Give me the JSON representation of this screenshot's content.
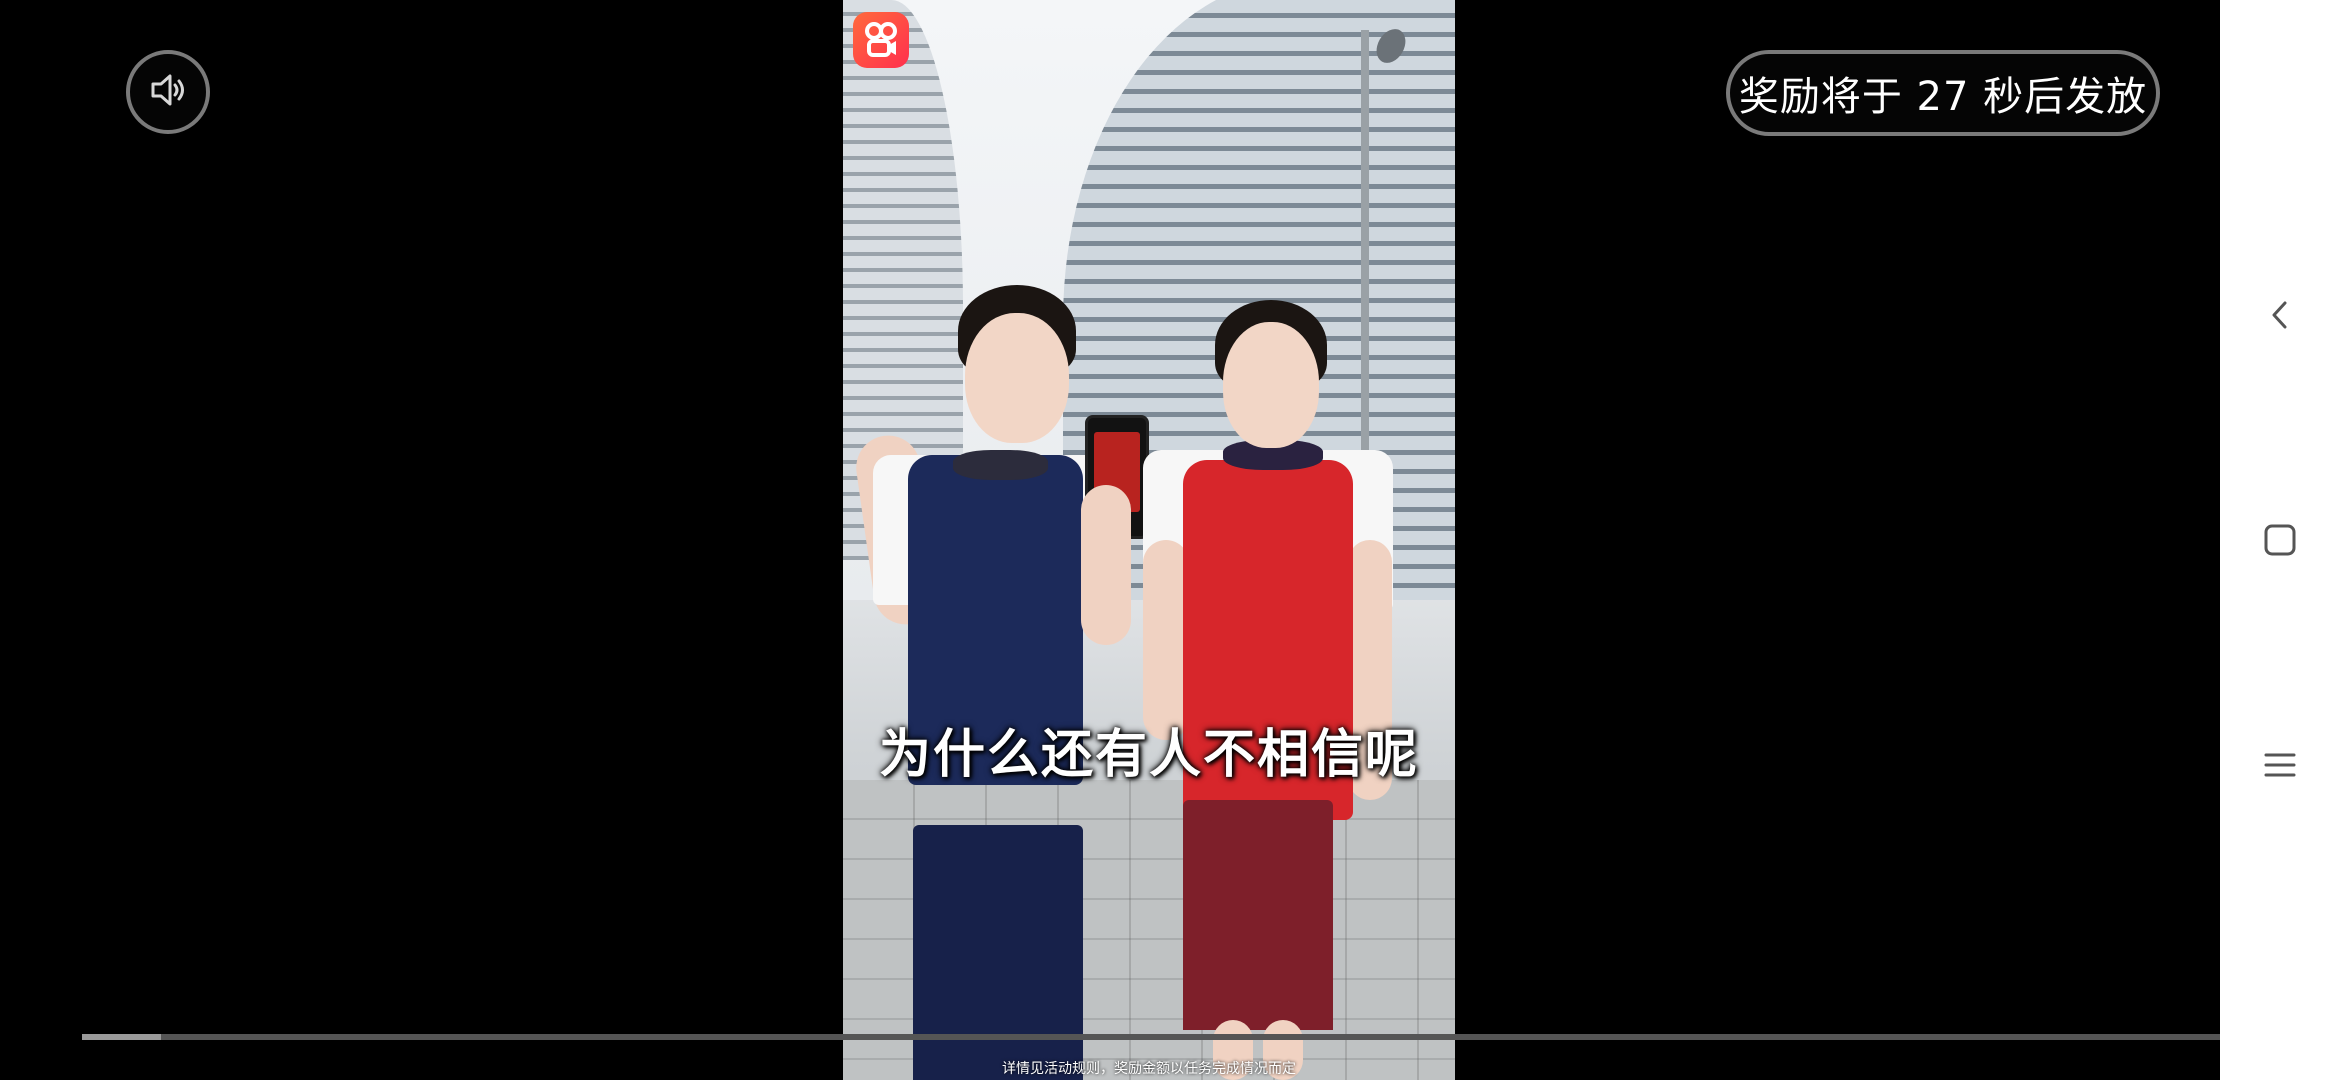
{
  "video": {
    "caption": "为什么还有人不相信呢",
    "disclaimer": "详情见活动规则，奖励金额以任务完成情况而定",
    "progress_fraction": 0.037
  },
  "reward_timer": {
    "text": "奖励将于 27 秒后发放"
  },
  "icons": {
    "sound": "volume-icon",
    "app_logo": "kuaishou-logo",
    "back": "back-icon",
    "home": "home-icon",
    "recents": "recents-icon"
  },
  "colors": {
    "background": "#000000",
    "nav_bar": "#ffffff",
    "logo_gradient_start": "#ff6a3c",
    "logo_gradient_end": "#ff2f4d",
    "progress_fill": "#9a9a9a",
    "progress_track": "#555555"
  }
}
